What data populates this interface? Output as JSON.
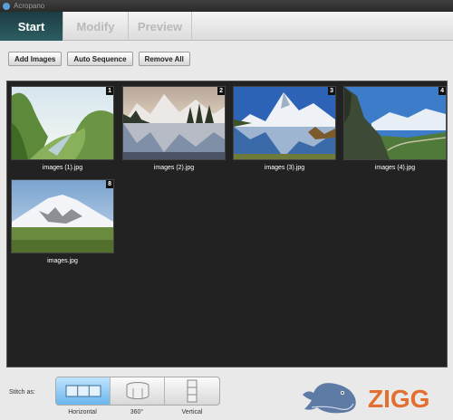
{
  "window": {
    "title": "Acropano"
  },
  "tabs": [
    {
      "label": "Start",
      "active": true
    },
    {
      "label": "Modify",
      "active": false
    },
    {
      "label": "Preview",
      "active": false
    }
  ],
  "toolbar": {
    "add_images": "Add Images",
    "auto_sequence": "Auto Sequence",
    "remove_all": "Remove All"
  },
  "images": [
    {
      "number": "1",
      "caption": "images (1).jpg"
    },
    {
      "number": "2",
      "caption": "images (2).jpg"
    },
    {
      "number": "3",
      "caption": "images (3).jpg"
    },
    {
      "number": "4",
      "caption": "images (4).jpg"
    },
    {
      "number": "8",
      "caption": "images.jpg"
    }
  ],
  "stitch": {
    "label": "Stitch as:",
    "options": [
      {
        "label": "Horizontal",
        "icon": "horizontal-stitch-icon",
        "active": true
      },
      {
        "label": "360°",
        "icon": "360-stitch-icon",
        "active": false
      },
      {
        "label": "Vertical",
        "icon": "vertical-stitch-icon",
        "active": false
      }
    ]
  },
  "watermark": {
    "text": "ZIGG",
    "accent": "#e2621b"
  }
}
